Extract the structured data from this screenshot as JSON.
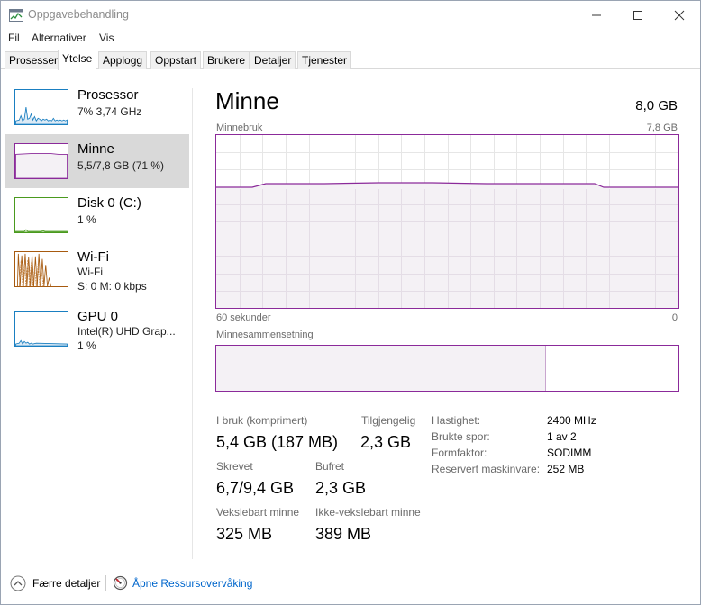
{
  "window": {
    "title": "Oppgavebehandling"
  },
  "menu": [
    "Fil",
    "Alternativer",
    "Vis"
  ],
  "tabs": [
    "Prosesser",
    "Ytelse",
    "Applogg",
    "Oppstart",
    "Brukere",
    "Detaljer",
    "Tjenester"
  ],
  "active_tab": "Ytelse",
  "sidebar": {
    "items": [
      {
        "title": "Prosessor",
        "sub1": "7% 3,74 GHz",
        "sub2": "",
        "color": "#1a7fc1"
      },
      {
        "title": "Minne",
        "sub1": "5,5/7,8 GB (71 %)",
        "sub2": "",
        "color": "#8b2a9a"
      },
      {
        "title": "Disk 0 (C:)",
        "sub1": "1 %",
        "sub2": "",
        "color": "#4a9a1e"
      },
      {
        "title": "Wi-Fi",
        "sub1": "Wi-Fi",
        "sub2": "S: 0  M: 0 kbps",
        "color": "#a75a0f"
      },
      {
        "title": "GPU 0",
        "sub1": "Intel(R) UHD Grap...",
        "sub2": "1 %",
        "color": "#1a7fc1"
      }
    ]
  },
  "main": {
    "title": "Minne",
    "total": "8,0 GB",
    "usage_label": "Minnebruk",
    "usage_max": "7,8 GB",
    "time_left": "60 sekunder",
    "time_right": "0",
    "composition_label": "Minnesammensetning",
    "usage_fraction": 0.71,
    "in_use_fraction_of_bar": 0.705
  },
  "stats": {
    "in_use_label": "I bruk (komprimert)",
    "in_use_value": "5,4 GB (187 MB)",
    "available_label": "Tilgjengelig",
    "available_value": "2,3 GB",
    "committed_label": "Skrevet",
    "committed_value": "6,7/9,4 GB",
    "cached_label": "Bufret",
    "cached_value": "2,3 GB",
    "paged_label": "Vekslebart minne",
    "paged_value": "325 MB",
    "nonpaged_label": "Ikke-vekslebart minne",
    "nonpaged_value": "389 MB"
  },
  "details": [
    {
      "label": "Hastighet:",
      "value": "2400 MHz"
    },
    {
      "label": "Brukte spor:",
      "value": "1 av 2"
    },
    {
      "label": "Formfaktor:",
      "value": "SODIMM"
    },
    {
      "label": "Reservert maskinvare:",
      "value": "252 MB"
    }
  ],
  "footer": {
    "fewer_details": "Færre detaljer",
    "open_monitor": "Åpne Ressursovervåking"
  },
  "colors": {
    "memory": "#8b2a9a",
    "memory_fill": "#f4f1f5",
    "grid": "#e6e6e6",
    "link": "#0066cc"
  }
}
